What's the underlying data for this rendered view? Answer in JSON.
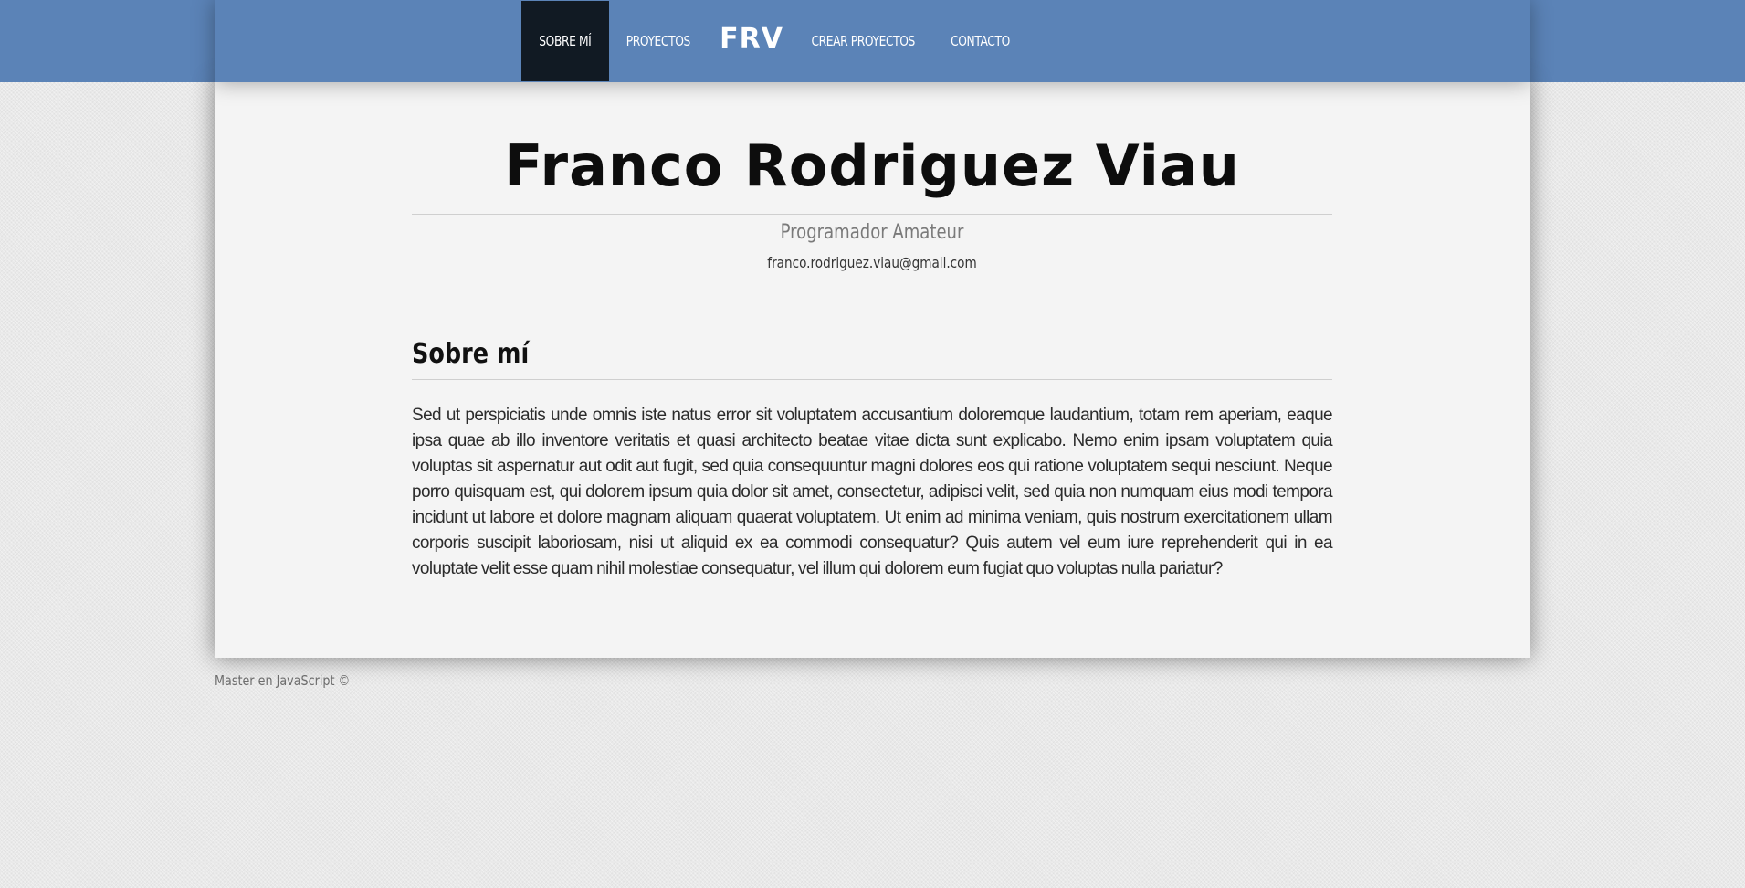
{
  "nav": {
    "items": [
      {
        "label": "SOBRE MÍ",
        "active": true
      },
      {
        "label": "PROYECTOS",
        "active": false
      },
      {
        "label": "FRV",
        "active": false,
        "is_logo": true
      },
      {
        "label": "CREAR PROYECTOS",
        "active": false
      },
      {
        "label": "CONTACTO",
        "active": false
      }
    ]
  },
  "profile": {
    "name": "Franco Rodriguez Viau",
    "subtitle": "Programador Amateur",
    "email": "franco.rodriguez.viau@gmail.com"
  },
  "about": {
    "title": "Sobre mí",
    "text": "Sed ut perspiciatis unde omnis iste natus error sit voluptatem accusantium doloremque laudantium, totam rem aperiam, eaque ipsa quae ab illo inventore veritatis et quasi architecto beatae vitae dicta sunt explicabo. Nemo enim ipsam voluptatem quia voluptas sit aspernatur aut odit aut fugit, sed quia consequuntur magni dolores eos qui ratione voluptatem sequi nesciunt. Neque porro quisquam est, qui dolorem ipsum quia dolor sit amet, consectetur, adipisci velit, sed quia non numquam eius modi tempora incidunt ut labore et dolore magnam aliquam quaerat voluptatem. Ut enim ad minima veniam, quis nostrum exercitationem ullam corporis suscipit laboriosam, nisi ut aliquid ex ea commodi consequatur? Quis autem vel eum iure reprehenderit qui in ea voluptate velit esse quam nihil molestiae consequatur, vel illum qui dolorem eum fugiat quo voluptas nulla pariatur?"
  },
  "footer": {
    "text": "Master en JavaScript ©"
  },
  "colors": {
    "header": "#5b83b7",
    "nav_active": "#111a23",
    "card": "#f4f4f4",
    "page_bg": "#e9e9e9"
  }
}
